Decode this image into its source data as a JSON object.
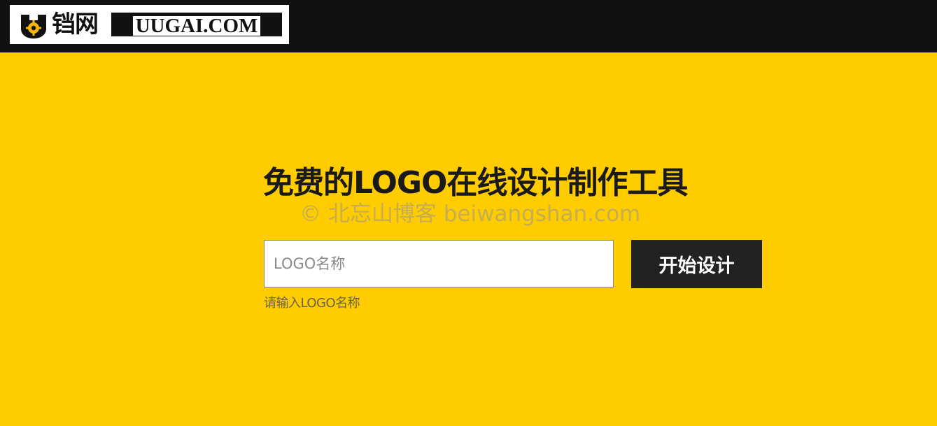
{
  "header": {
    "logo": {
      "cn_text": "铛网",
      "en_text": "UUGAI.COM"
    }
  },
  "hero": {
    "title": "免费的LOGO在线设计制作工具",
    "watermark": "© 北忘山博客 beiwangshan.com"
  },
  "form": {
    "name_input": {
      "placeholder": "LOGO名称",
      "value": ""
    },
    "start_button_label": "开始设计",
    "hint": "请输入LOGO名称"
  },
  "colors": {
    "background": "#ffcc00",
    "topbar": "#111111",
    "button": "#222222"
  }
}
